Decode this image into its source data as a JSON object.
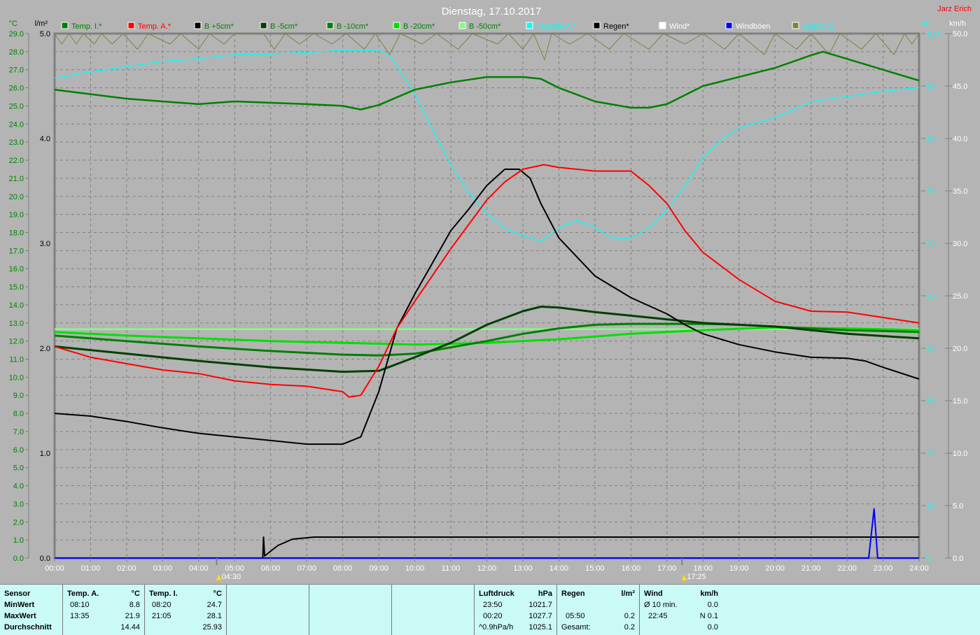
{
  "header": {
    "title": "Dienstag, 17.10.2017",
    "author": "Jarz Erich"
  },
  "chart_data": {
    "type": "line",
    "title": "Dienstag, 17.10.2017",
    "xlabel": "",
    "x_range_hours": [
      0,
      24
    ],
    "x_ticks": [
      "00:00",
      "01:00",
      "02:00",
      "03:00",
      "04:00",
      "05:00",
      "06:00",
      "07:00",
      "08:00",
      "09:00",
      "10:00",
      "11:00",
      "12:00",
      "13:00",
      "14:00",
      "15:00",
      "16:00",
      "17:00",
      "18:00",
      "19:00",
      "20:00",
      "21:00",
      "22:00",
      "23:00",
      "24:00"
    ],
    "axes": {
      "temp": {
        "unit": "°C",
        "range": [
          0,
          29
        ],
        "ticks": [
          "0.0",
          "1.0",
          "2.0",
          "3.0",
          "4.0",
          "5.0",
          "6.0",
          "7.0",
          "8.0",
          "9.0",
          "10.0",
          "11.0",
          "12.0",
          "13.0",
          "14.0",
          "15.0",
          "16.0",
          "17.0",
          "18.0",
          "19.0",
          "20.0",
          "21.0",
          "22.0",
          "23.0",
          "24.0",
          "25.0",
          "26.0",
          "27.0",
          "28.0",
          "29.0"
        ]
      },
      "rain": {
        "unit": "l/m²",
        "range": [
          0,
          5
        ],
        "ticks": [
          "0.0",
          "1.0",
          "2.0",
          "3.0",
          "4.0",
          "5.0"
        ]
      },
      "humidity": {
        "unit": "%",
        "range": [
          0,
          100
        ],
        "ticks": [
          "0",
          "10",
          "20",
          "30",
          "40",
          "50",
          "60",
          "70",
          "80",
          "90",
          "100"
        ]
      },
      "wind": {
        "unit": "km/h",
        "range": [
          0,
          50
        ],
        "ticks": [
          "0.0",
          "5.0",
          "10.0",
          "15.0",
          "20.0",
          "25.0",
          "30.0",
          "35.0",
          "40.0",
          "45.0",
          "50.0"
        ]
      }
    },
    "sun": {
      "sunrise": "04:30",
      "sunset": "17:25"
    },
    "series": [
      {
        "name": "Temp. I.*",
        "color": "#008000",
        "axis": "temp",
        "width": 2.5,
        "points": [
          [
            0,
            25.9
          ],
          [
            2,
            25.4
          ],
          [
            4,
            25.1
          ],
          [
            5,
            25.25
          ],
          [
            7,
            25.1
          ],
          [
            8,
            25.0
          ],
          [
            8.5,
            24.8
          ],
          [
            9,
            25.05
          ],
          [
            10,
            25.9
          ],
          [
            11,
            26.3
          ],
          [
            12,
            26.6
          ],
          [
            13,
            26.6
          ],
          [
            13.5,
            26.5
          ],
          [
            14,
            26.0
          ],
          [
            15,
            25.25
          ],
          [
            16,
            24.9
          ],
          [
            16.5,
            24.9
          ],
          [
            17,
            25.1
          ],
          [
            18,
            26.1
          ],
          [
            19,
            26.6
          ],
          [
            20,
            27.1
          ],
          [
            21,
            27.8
          ],
          [
            21.33,
            28.0
          ],
          [
            22,
            27.6
          ],
          [
            23,
            27.0
          ],
          [
            24,
            26.4
          ]
        ]
      },
      {
        "name": "Temp. A.*",
        "color": "#ff0000",
        "axis": "temp",
        "width": 2,
        "points": [
          [
            0,
            11.7
          ],
          [
            1,
            11.1
          ],
          [
            2,
            10.75
          ],
          [
            3,
            10.4
          ],
          [
            4,
            10.2
          ],
          [
            5,
            9.8
          ],
          [
            6,
            9.6
          ],
          [
            7,
            9.5
          ],
          [
            8,
            9.2
          ],
          [
            8.17,
            8.9
          ],
          [
            8.5,
            9.0
          ],
          [
            9,
            10.6
          ],
          [
            9.5,
            12.7
          ],
          [
            10,
            14.2
          ],
          [
            11,
            17.1
          ],
          [
            12,
            19.8
          ],
          [
            12.5,
            20.8
          ],
          [
            13,
            21.5
          ],
          [
            13.58,
            21.75
          ],
          [
            14,
            21.6
          ],
          [
            15,
            21.4
          ],
          [
            16,
            21.4
          ],
          [
            16.5,
            20.6
          ],
          [
            17,
            19.6
          ],
          [
            17.5,
            18.1
          ],
          [
            18,
            16.9
          ],
          [
            19,
            15.4
          ],
          [
            20,
            14.2
          ],
          [
            21,
            13.65
          ],
          [
            22,
            13.6
          ],
          [
            23,
            13.3
          ],
          [
            24,
            13.0
          ]
        ]
      },
      {
        "name": "B +5cm*",
        "color": "#000000",
        "axis": "temp",
        "width": 2,
        "points": [
          [
            0,
            8.0
          ],
          [
            1,
            7.85
          ],
          [
            2,
            7.55
          ],
          [
            3,
            7.2
          ],
          [
            4,
            6.9
          ],
          [
            5,
            6.7
          ],
          [
            6,
            6.5
          ],
          [
            7,
            6.3
          ],
          [
            8,
            6.3
          ],
          [
            8.5,
            6.7
          ],
          [
            9,
            9.2
          ],
          [
            9.5,
            12.7
          ],
          [
            10,
            14.6
          ],
          [
            11,
            18.1
          ],
          [
            11.5,
            19.3
          ],
          [
            12,
            20.6
          ],
          [
            12.5,
            21.5
          ],
          [
            12.9,
            21.5
          ],
          [
            13.2,
            21.0
          ],
          [
            13.5,
            19.6
          ],
          [
            14,
            17.7
          ],
          [
            15,
            15.6
          ],
          [
            16,
            14.4
          ],
          [
            17,
            13.5
          ],
          [
            17.5,
            12.9
          ],
          [
            18,
            12.4
          ],
          [
            19,
            11.8
          ],
          [
            20,
            11.4
          ],
          [
            21,
            11.1
          ],
          [
            22,
            11.05
          ],
          [
            22.5,
            10.9
          ],
          [
            23,
            10.55
          ],
          [
            24,
            9.9
          ]
        ]
      },
      {
        "name": "B -5cm*",
        "color": "#004000",
        "axis": "temp",
        "width": 3,
        "points": [
          [
            0,
            11.7
          ],
          [
            2,
            11.3
          ],
          [
            4,
            10.9
          ],
          [
            6,
            10.55
          ],
          [
            8,
            10.3
          ],
          [
            9,
            10.35
          ],
          [
            10,
            11.1
          ],
          [
            11,
            11.9
          ],
          [
            12,
            12.9
          ],
          [
            13,
            13.65
          ],
          [
            13.5,
            13.9
          ],
          [
            14,
            13.85
          ],
          [
            15,
            13.6
          ],
          [
            16,
            13.4
          ],
          [
            17,
            13.2
          ],
          [
            18,
            13.0
          ],
          [
            19,
            12.9
          ],
          [
            20,
            12.8
          ],
          [
            21,
            12.6
          ],
          [
            22,
            12.4
          ],
          [
            24,
            12.15
          ]
        ]
      },
      {
        "name": "B -10cm*",
        "color": "#008000",
        "axis": "temp",
        "width": 3,
        "points": [
          [
            0,
            12.3
          ],
          [
            2,
            12.0
          ],
          [
            4,
            11.7
          ],
          [
            6,
            11.45
          ],
          [
            8,
            11.25
          ],
          [
            9,
            11.2
          ],
          [
            10,
            11.3
          ],
          [
            11,
            11.65
          ],
          [
            12,
            12.0
          ],
          [
            13,
            12.4
          ],
          [
            14,
            12.7
          ],
          [
            15,
            12.9
          ],
          [
            16,
            12.95
          ],
          [
            18,
            12.95
          ],
          [
            19,
            12.9
          ],
          [
            20,
            12.8
          ],
          [
            22,
            12.6
          ],
          [
            24,
            12.5
          ]
        ]
      },
      {
        "name": "B -20cm*",
        "color": "#00e000",
        "axis": "temp",
        "width": 3,
        "points": [
          [
            0,
            12.5
          ],
          [
            2,
            12.3
          ],
          [
            4,
            12.15
          ],
          [
            6,
            12.0
          ],
          [
            8,
            11.9
          ],
          [
            10,
            11.8
          ],
          [
            12,
            11.9
          ],
          [
            14,
            12.1
          ],
          [
            16,
            12.4
          ],
          [
            18,
            12.6
          ],
          [
            20,
            12.75
          ],
          [
            22,
            12.7
          ],
          [
            24,
            12.6
          ]
        ]
      },
      {
        "name": "B -50cm*",
        "color": "#80ff80",
        "axis": "temp",
        "width": 2.5,
        "points": [
          [
            0,
            12.65
          ],
          [
            24,
            12.65
          ]
        ]
      },
      {
        "name": "Feuchte A.*",
        "color": "#00ffff",
        "axis": "humidity",
        "width": 1.3,
        "points": [
          [
            0,
            91.5
          ],
          [
            1,
            92.7
          ],
          [
            2,
            93.7
          ],
          [
            3,
            94.7
          ],
          [
            4,
            95.2
          ],
          [
            5,
            96
          ],
          [
            6,
            96.1
          ],
          [
            7,
            96.4
          ],
          [
            8,
            96.8
          ],
          [
            9,
            96.8
          ],
          [
            9.33,
            95.7
          ],
          [
            10,
            88.4
          ],
          [
            11,
            75
          ],
          [
            11.5,
            69.7
          ],
          [
            12,
            65.7
          ],
          [
            12.5,
            62.8
          ],
          [
            13,
            61.5
          ],
          [
            13.5,
            60.4
          ],
          [
            14,
            63
          ],
          [
            14.5,
            64.4
          ],
          [
            15,
            63
          ],
          [
            15.5,
            61
          ],
          [
            16,
            61
          ],
          [
            16.5,
            63
          ],
          [
            17,
            66.4
          ],
          [
            17.5,
            71
          ],
          [
            18,
            76.4
          ],
          [
            18.5,
            79.7
          ],
          [
            19,
            82
          ],
          [
            20,
            84
          ],
          [
            21,
            87
          ],
          [
            22,
            88
          ],
          [
            23,
            89
          ],
          [
            24,
            89.7
          ]
        ]
      },
      {
        "name": "Regen*",
        "color": "#000000",
        "axis": "rain",
        "width": 2,
        "points": [
          [
            0,
            0
          ],
          [
            5.78,
            0
          ],
          [
            5.8,
            0.2
          ],
          [
            5.83,
            0.02
          ],
          [
            6.2,
            0.12
          ],
          [
            6.6,
            0.18
          ],
          [
            7.2,
            0.2
          ],
          [
            24,
            0.2
          ]
        ]
      },
      {
        "name": "Wind*",
        "color": "#ffffff",
        "axis": "wind",
        "width": 1,
        "points": []
      },
      {
        "name": "Windböen",
        "color": "#0000ff",
        "axis": "wind",
        "width": 2,
        "points": [
          [
            0,
            0
          ],
          [
            22.6,
            0
          ],
          [
            22.75,
            4.7
          ],
          [
            22.85,
            0
          ],
          [
            24,
            0
          ]
        ]
      },
      {
        "name": "Empfang",
        "color": "#808040",
        "axis": "humidity",
        "width": 1,
        "points": [
          [
            0,
            100
          ],
          [
            0.2,
            98
          ],
          [
            0.4,
            100
          ],
          [
            0.6,
            98
          ],
          [
            0.8,
            100
          ],
          [
            1.1,
            98
          ],
          [
            1.3,
            100
          ],
          [
            1.6,
            98
          ],
          [
            1.9,
            100
          ],
          [
            2.3,
            97
          ],
          [
            2.6,
            100
          ],
          [
            3.2,
            98
          ],
          [
            3.5,
            100
          ],
          [
            4,
            97
          ],
          [
            4.3,
            100
          ],
          [
            4.7,
            98
          ],
          [
            5.0,
            100
          ],
          [
            5.8,
            100
          ],
          [
            6.1,
            97
          ],
          [
            6.4,
            100
          ],
          [
            6.8,
            98
          ],
          [
            7.2,
            100
          ],
          [
            7.7,
            98
          ],
          [
            8.1,
            100
          ],
          [
            8.6,
            97
          ],
          [
            8.9,
            100
          ],
          [
            9.3,
            96
          ],
          [
            9.6,
            100
          ],
          [
            10.2,
            98
          ],
          [
            10.6,
            100
          ],
          [
            11.2,
            97
          ],
          [
            11.6,
            100
          ],
          [
            12.3,
            98
          ],
          [
            12.6,
            100
          ],
          [
            13.0,
            97
          ],
          [
            13.3,
            100
          ],
          [
            13.6,
            95
          ],
          [
            13.8,
            100
          ],
          [
            14.3,
            98
          ],
          [
            14.8,
            100
          ],
          [
            15.4,
            97
          ],
          [
            15.8,
            100
          ],
          [
            16.5,
            97
          ],
          [
            16.9,
            100
          ],
          [
            17.5,
            98
          ],
          [
            18.0,
            100
          ],
          [
            18.6,
            97
          ],
          [
            19.0,
            100
          ],
          [
            19.7,
            96
          ],
          [
            20.0,
            100
          ],
          [
            20.6,
            97
          ],
          [
            21.0,
            100
          ],
          [
            21.5,
            96
          ],
          [
            21.8,
            100
          ],
          [
            22.4,
            97
          ],
          [
            22.8,
            100
          ],
          [
            23.3,
            96
          ],
          [
            23.6,
            100
          ],
          [
            23.8,
            98
          ],
          [
            24,
            100
          ]
        ]
      }
    ]
  },
  "table": {
    "sensor": {
      "header": "Sensor",
      "rows": [
        "MinWert",
        "MaxWert",
        "Durchschnitt"
      ]
    },
    "temp_a": {
      "header": "Temp. A.",
      "unit": "°C",
      "min_time": "08:10",
      "min": "8.8",
      "max_time": "13:35",
      "max": "21.9",
      "avg": "14.44"
    },
    "temp_i": {
      "header": "Temp. I.",
      "unit": "°C",
      "min_time": "08:20",
      "min": "24.7",
      "max_time": "21:05",
      "max": "28.1",
      "avg": "25.93"
    },
    "luftdruck": {
      "header": "Luftdruck",
      "unit": "hPa",
      "r1a": "23:50",
      "r1b": "1021.7",
      "r2a": "00:20",
      "r2b": "1027.7",
      "r3a": "^0.9hPa/h",
      "r3b": "1025.1"
    },
    "regen": {
      "header": "Regen",
      "unit": "l/m²",
      "r2a": "05:50",
      "r2b": "0.2",
      "r3a": "Gesamt:",
      "r3b": "0.2"
    },
    "wind": {
      "header": "Wind",
      "unit": "km/h",
      "r1a": "Ø 10 min.",
      "r1b": "0.0",
      "r2a": "22:45",
      "r2b": "N 0.1",
      "r3b": "0.0"
    }
  }
}
